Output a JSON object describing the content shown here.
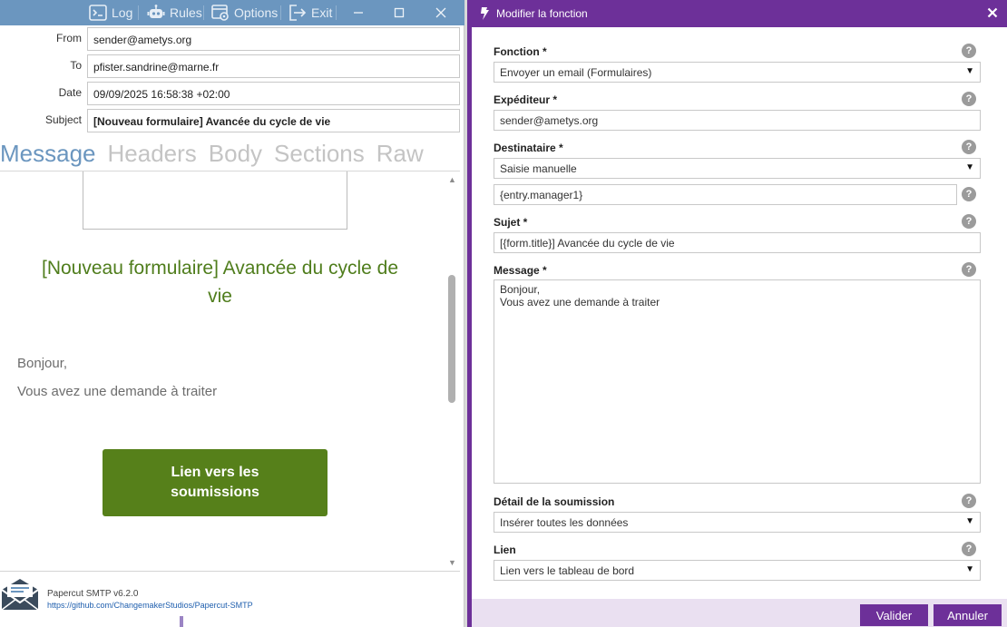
{
  "papercut": {
    "toolbar": {
      "log": "Log",
      "rules": "Rules",
      "options": "Options",
      "exit": "Exit",
      "icons": [
        "terminal-icon",
        "robot-icon",
        "settings-window-icon",
        "exit-icon"
      ]
    },
    "window_controls": [
      "minimize",
      "maximize",
      "close"
    ],
    "headers": {
      "from_label": "From",
      "from_value": "sender@ametys.org",
      "to_label": "To",
      "to_value": "pfister.sandrine@marne.fr",
      "date_label": "Date",
      "date_value": "09/09/2025 16:58:38 +02:00",
      "subject_label": "Subject",
      "subject_value": "[Nouveau formulaire] Avancée du cycle de vie"
    },
    "tabs": [
      "Message",
      "Headers",
      "Body",
      "Sections",
      "Raw"
    ],
    "active_tab": "Message",
    "message": {
      "title": "[Nouveau formulaire] Avancée du cycle de vie",
      "greeting": "Bonjour,",
      "body": "Vous avez une demande à traiter",
      "button": "Lien vers les soumissions",
      "title_color": "#4f7d1c",
      "button_color": "#56801a"
    },
    "footer": {
      "app_name": "Papercut SMTP v6.2.0",
      "link": "https://github.com/ChangemakerStudios/Papercut-SMTP"
    },
    "accent_color": "#6b96bf"
  },
  "dialog": {
    "title": "Modifier la fonction",
    "accent_color": "#6d3099",
    "fields": {
      "fonction_label": "Fonction *",
      "fonction_value": "Envoyer un email (Formulaires)",
      "expediteur_label": "Expéditeur *",
      "expediteur_value": "sender@ametys.org",
      "destinataire_label": "Destinataire *",
      "destinataire_value": "Saisie manuelle",
      "destinataire_extra": "{entry.manager1}",
      "sujet_label": "Sujet *",
      "sujet_value": "[{form.title}] Avancée du cycle de vie",
      "message_label": "Message *",
      "message_value": "Bonjour,\nVous avez une demande à traiter",
      "detail_label": "Détail de la soumission",
      "detail_value": "Insérer toutes les données",
      "lien_label": "Lien",
      "lien_value": "Lien vers le tableau de bord"
    },
    "help_glyph": "?",
    "buttons": {
      "validate": "Valider",
      "cancel": "Annuler"
    }
  }
}
